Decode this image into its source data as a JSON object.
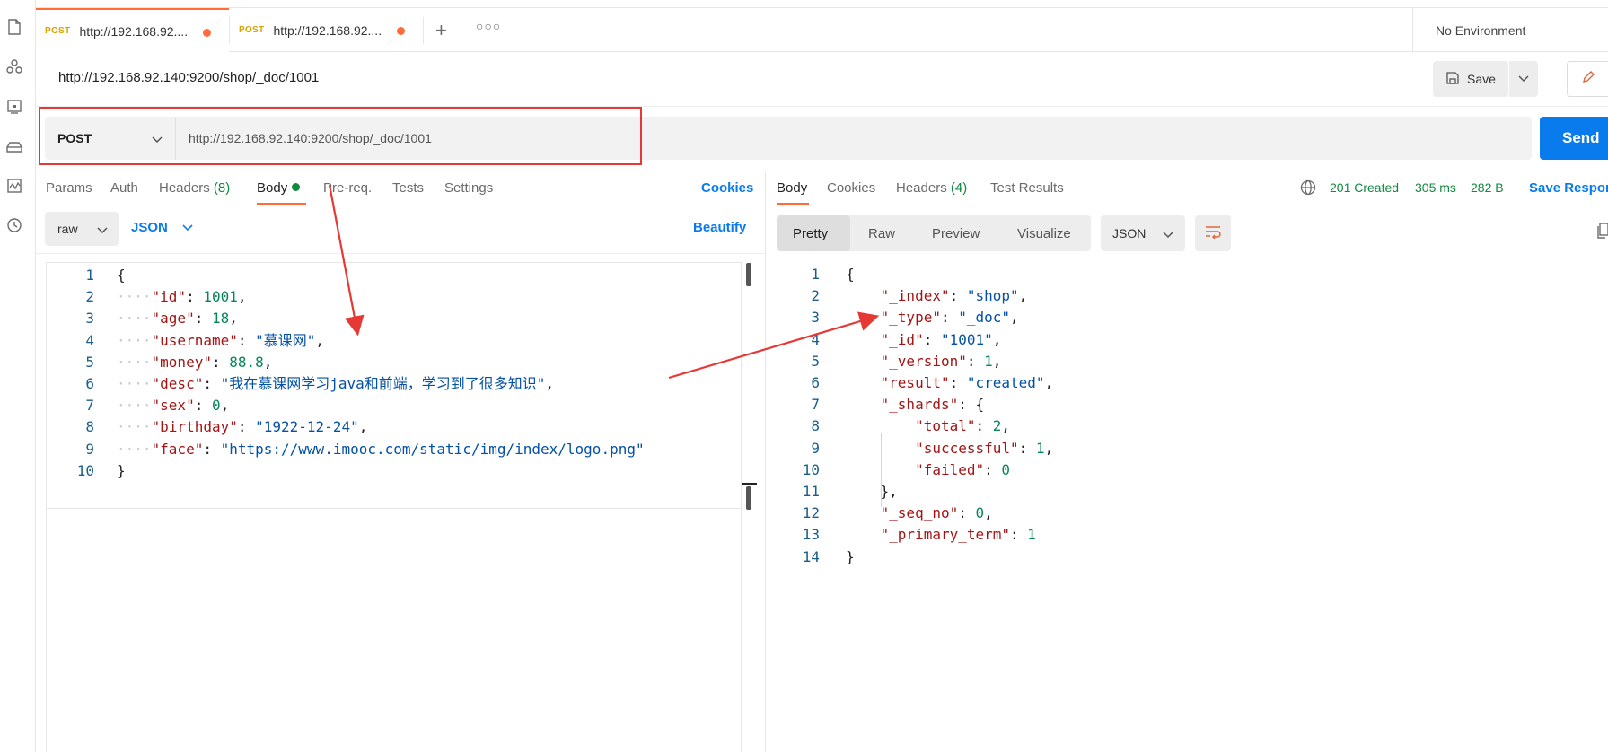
{
  "tabs": [
    {
      "method": "POST",
      "title": "http://192.168.92...."
    },
    {
      "method": "POST",
      "title": "http://192.168.92...."
    }
  ],
  "environment": "No Environment",
  "breadcrumb": "http://192.168.92.140:9200/shop/_doc/1001",
  "toolbar": {
    "save_label": "Save"
  },
  "request": {
    "method": "POST",
    "url": "http://192.168.92.140:9200/shop/_doc/1001",
    "send_label": "Send"
  },
  "request_tabs": {
    "params": "Params",
    "auth": "Auth",
    "headers": "Headers",
    "headers_count": "(8)",
    "body": "Body",
    "prereq": "Pre-req.",
    "tests": "Tests",
    "settings": "Settings",
    "cookies": "Cookies"
  },
  "body_options": {
    "mode": "raw",
    "language": "JSON",
    "beautify": "Beautify"
  },
  "request_body": [
    {
      "n": "1",
      "indent": "",
      "key": "",
      "sep": "",
      "val": "{",
      "type": "p",
      "end": ""
    },
    {
      "n": "2",
      "indent": "····",
      "key": "\"id\"",
      "sep": ": ",
      "val": "1001",
      "type": "n",
      "end": ","
    },
    {
      "n": "3",
      "indent": "····",
      "key": "\"age\"",
      "sep": ": ",
      "val": "18",
      "type": "n",
      "end": ","
    },
    {
      "n": "4",
      "indent": "····",
      "key": "\"username\"",
      "sep": ": ",
      "val": "\"慕课网\"",
      "type": "s",
      "end": ","
    },
    {
      "n": "5",
      "indent": "····",
      "key": "\"money\"",
      "sep": ": ",
      "val": "88.8",
      "type": "n",
      "end": ","
    },
    {
      "n": "6",
      "indent": "····",
      "key": "\"desc\"",
      "sep": ": ",
      "val": "\"我在慕课网学习java和前端，学习到了很多知识\"",
      "type": "s",
      "end": ","
    },
    {
      "n": "7",
      "indent": "····",
      "key": "\"sex\"",
      "sep": ": ",
      "val": "0",
      "type": "n",
      "end": ","
    },
    {
      "n": "8",
      "indent": "····",
      "key": "\"birthday\"",
      "sep": ": ",
      "val": "\"1922-12-24\"",
      "type": "s",
      "end": ","
    },
    {
      "n": "9",
      "indent": "····",
      "key": "\"face\"",
      "sep": ": ",
      "val": "\"https://www.imooc.com/static/img/index/logo.png\"",
      "type": "s",
      "end": ""
    },
    {
      "n": "10",
      "indent": "",
      "key": "",
      "sep": "",
      "val": "}",
      "type": "p",
      "end": ""
    }
  ],
  "response_tabs": {
    "body": "Body",
    "cookies": "Cookies",
    "headers": "Headers",
    "headers_count": "(4)",
    "test_results": "Test Results"
  },
  "response_status": {
    "code": "201 Created",
    "time": "305 ms",
    "size": "282 B",
    "save": "Save Response"
  },
  "response_view": {
    "pretty": "Pretty",
    "raw": "Raw",
    "preview": "Preview",
    "visualize": "Visualize",
    "format": "JSON"
  },
  "response_body": [
    {
      "n": "1",
      "indent": "",
      "key": "",
      "sep": "",
      "val": "{",
      "type": "p",
      "end": ""
    },
    {
      "n": "2",
      "indent": "    ",
      "key": "\"_index\"",
      "sep": ": ",
      "val": "\"shop\"",
      "type": "s",
      "end": ","
    },
    {
      "n": "3",
      "indent": "    ",
      "key": "\"_type\"",
      "sep": ": ",
      "val": "\"_doc\"",
      "type": "s",
      "end": ","
    },
    {
      "n": "4",
      "indent": "    ",
      "key": "\"_id\"",
      "sep": ": ",
      "val": "\"1001\"",
      "type": "s",
      "end": ","
    },
    {
      "n": "5",
      "indent": "    ",
      "key": "\"_version\"",
      "sep": ": ",
      "val": "1",
      "type": "n",
      "end": ","
    },
    {
      "n": "6",
      "indent": "    ",
      "key": "\"result\"",
      "sep": ": ",
      "val": "\"created\"",
      "type": "s",
      "end": ","
    },
    {
      "n": "7",
      "indent": "    ",
      "key": "\"_shards\"",
      "sep": ": ",
      "val": "{",
      "type": "p",
      "end": ""
    },
    {
      "n": "8",
      "indent": "        ",
      "key": "\"total\"",
      "sep": ": ",
      "val": "2",
      "type": "n",
      "end": ","
    },
    {
      "n": "9",
      "indent": "        ",
      "key": "\"successful\"",
      "sep": ": ",
      "val": "1",
      "type": "n",
      "end": ","
    },
    {
      "n": "10",
      "indent": "        ",
      "key": "\"failed\"",
      "sep": ": ",
      "val": "0",
      "type": "n",
      "end": ""
    },
    {
      "n": "11",
      "indent": "    ",
      "key": "",
      "sep": "",
      "val": "}",
      "type": "p",
      "end": ","
    },
    {
      "n": "12",
      "indent": "    ",
      "key": "\"_seq_no\"",
      "sep": ": ",
      "val": "0",
      "type": "n",
      "end": ","
    },
    {
      "n": "13",
      "indent": "    ",
      "key": "\"_primary_term\"",
      "sep": ": ",
      "val": "1",
      "type": "n",
      "end": ""
    },
    {
      "n": "14",
      "indent": "",
      "key": "",
      "sep": "",
      "val": "}",
      "type": "p",
      "end": ""
    }
  ],
  "colors": {
    "accent": "#ff6c37",
    "link": "#097bed",
    "success": "#0f8a3e",
    "annotation": "#e53935"
  },
  "icons": [
    "file-icon",
    "apis-icon",
    "mock-icon",
    "environment-icon",
    "monitor-icon",
    "history-icon",
    "save-icon",
    "pencil-icon",
    "globe-icon",
    "wrap-icon",
    "copy-icon"
  ]
}
